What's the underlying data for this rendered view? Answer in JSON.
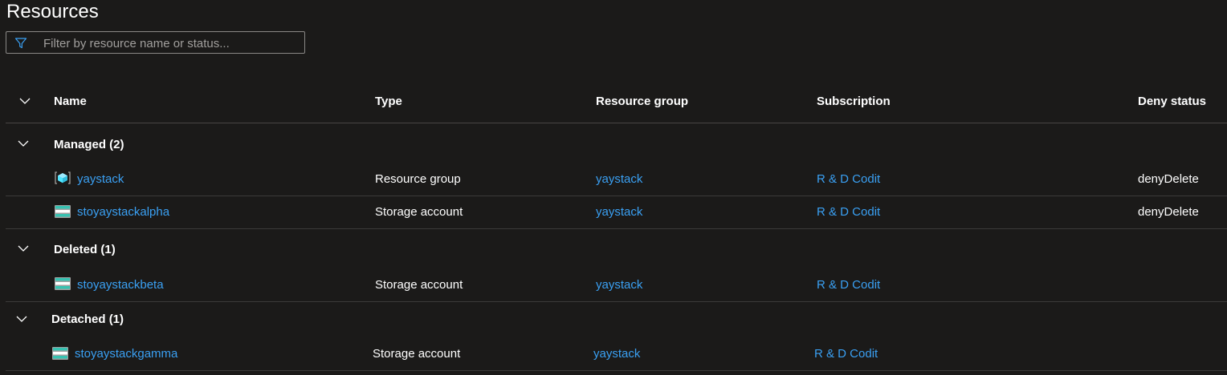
{
  "page": {
    "title": "Resources"
  },
  "filter": {
    "placeholder": "Filter by resource name or status..."
  },
  "columns": {
    "name": "Name",
    "type": "Type",
    "resource_group": "Resource group",
    "subscription": "Subscription",
    "deny_status": "Deny status"
  },
  "groups": [
    {
      "label": "Managed (2)",
      "rows": [
        {
          "name": "yaystack",
          "icon": "resource-group-icon",
          "type": "Resource group",
          "resource_group": "yaystack",
          "subscription": "R & D Codit",
          "deny_status": "denyDelete"
        },
        {
          "name": "stoyaystackalpha",
          "icon": "storage-account-icon",
          "type": "Storage account",
          "resource_group": "yaystack",
          "subscription": "R & D Codit",
          "deny_status": "denyDelete"
        }
      ]
    },
    {
      "label": "Deleted (1)",
      "rows": [
        {
          "name": "stoyaystackbeta",
          "icon": "storage-account-icon",
          "type": "Storage account",
          "resource_group": "yaystack",
          "subscription": "R & D Codit",
          "deny_status": ""
        }
      ]
    },
    {
      "label": "Detached (1)",
      "rows": [
        {
          "name": "stoyaystackgamma",
          "icon": "storage-account-icon",
          "type": "Storage account",
          "resource_group": "yaystack",
          "subscription": "R & D Codit",
          "deny_status": ""
        }
      ]
    }
  ]
}
